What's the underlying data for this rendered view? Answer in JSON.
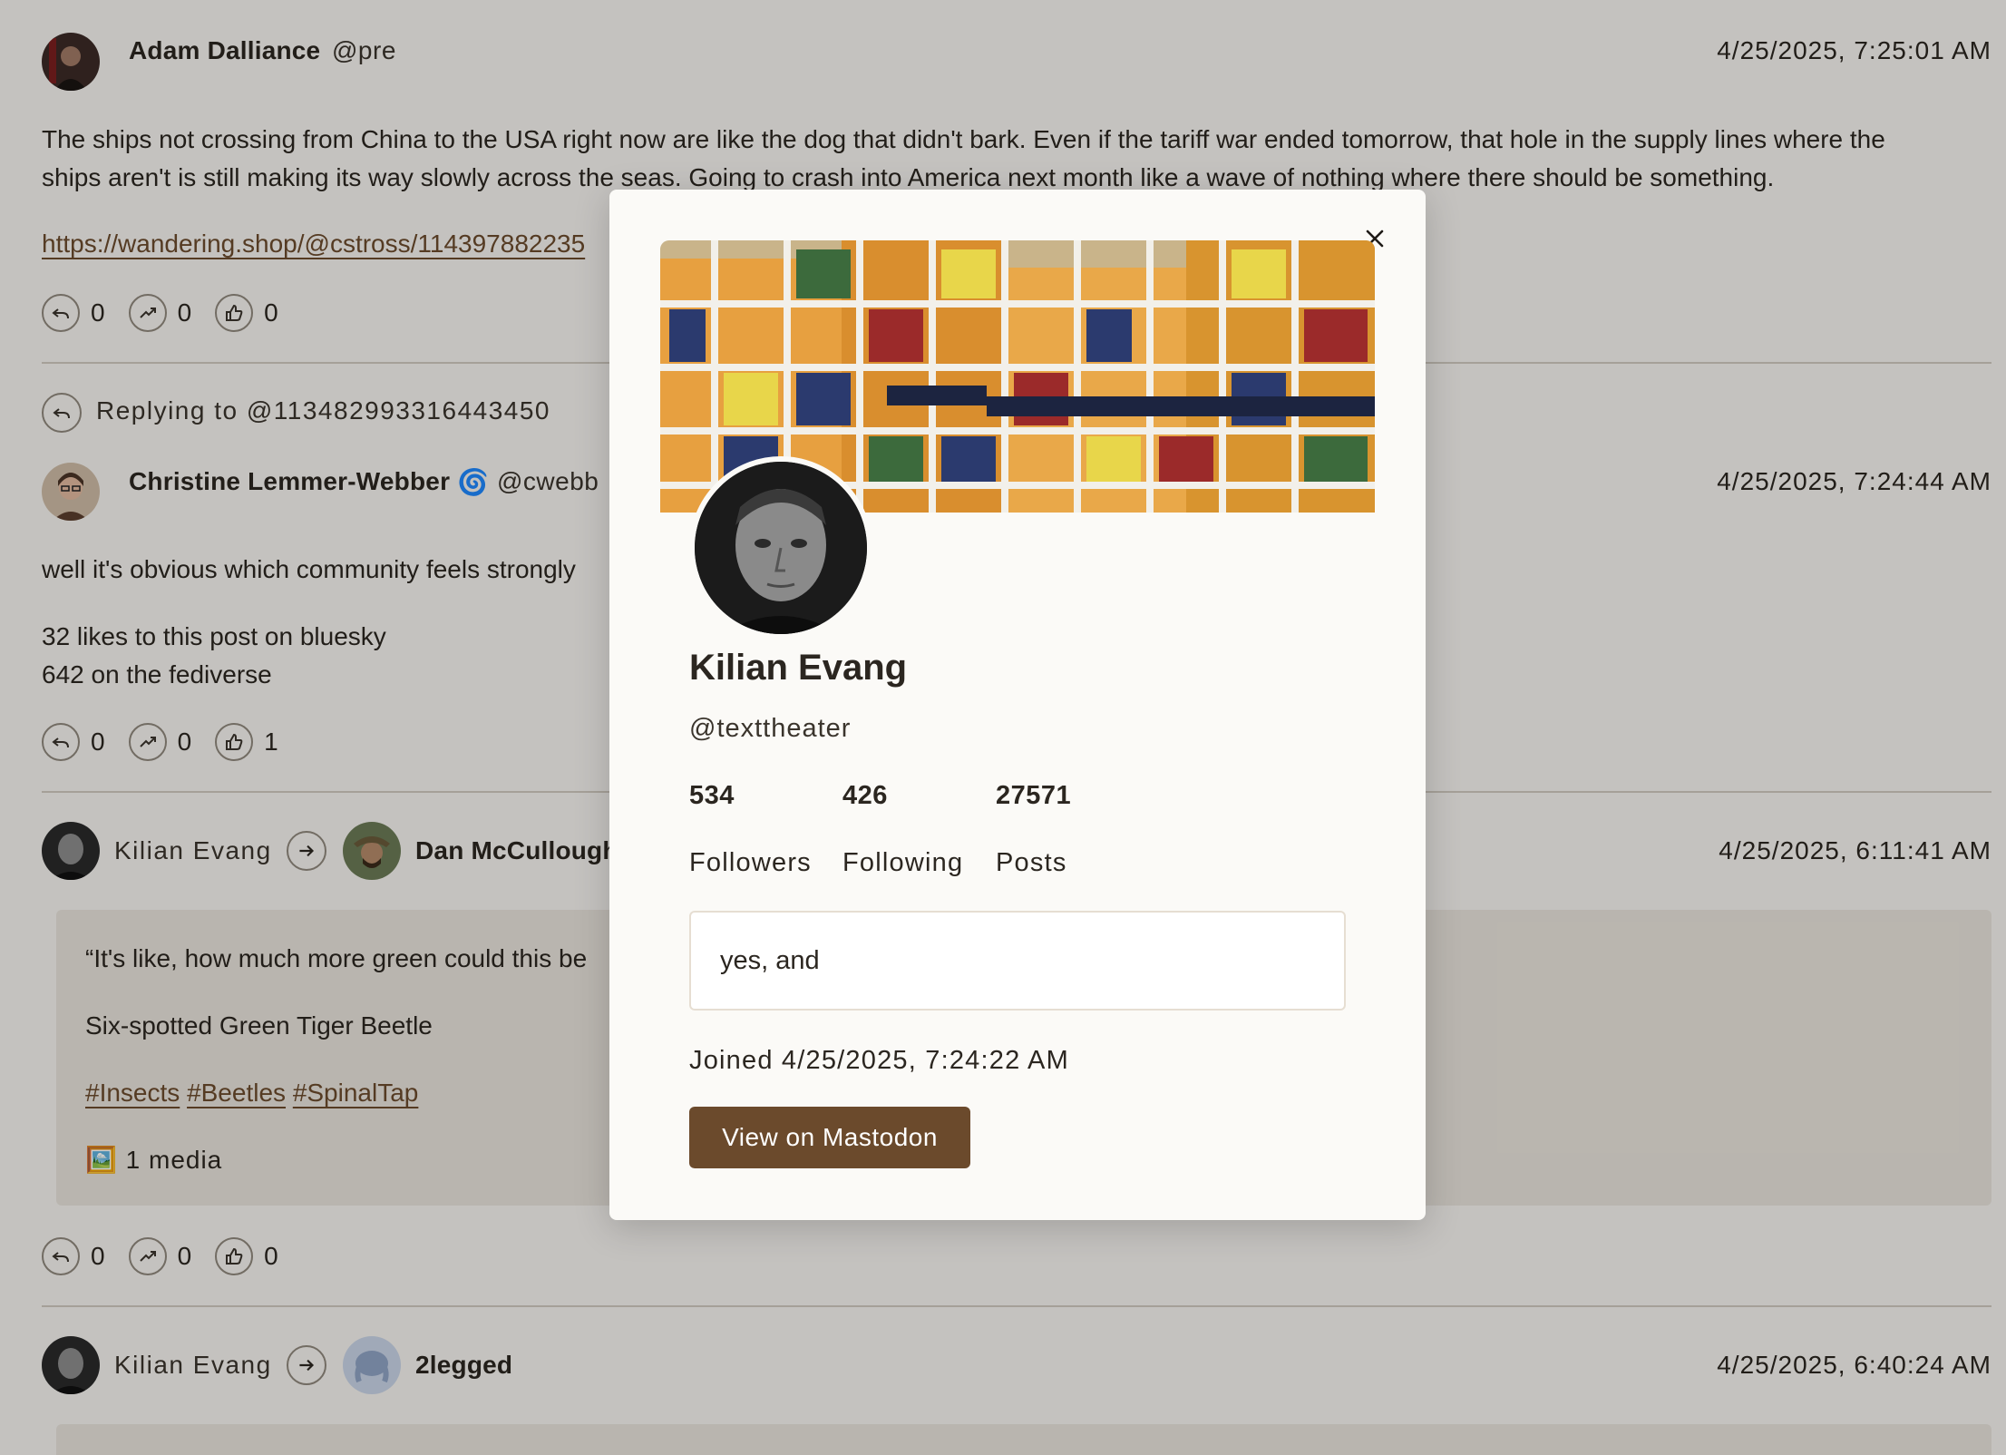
{
  "posts": [
    {
      "author_name": "Adam Dalliance",
      "author_handle": "@pre",
      "timestamp": "4/25/2025, 7:25:01 AM",
      "text_line1": "The ships not crossing from China to the USA right now are like the dog that didn't bark. Even if the tariff war ended tomorrow, that hole in the supply lines where the",
      "text_line2": "ships aren't is still making its way slowly across the seas. Going to crash into America next month like a wave of nothing where there should be something.",
      "link": "https://wandering.shop/@cstross/114397882235",
      "replies": "0",
      "boosts": "0",
      "likes": "0"
    },
    {
      "reply_to": "Replying to @113482993316443450",
      "author_name": "Christine Lemmer-Webber",
      "author_badge": "🌀",
      "author_handle": "@cwebb",
      "timestamp": "4/25/2025, 7:24:44 AM",
      "text_line1": "well it's obvious which community feels strongly",
      "text_line2": "32 likes to this post on bluesky",
      "text_line3": "642 on the fediverse",
      "replies": "0",
      "boosts": "0",
      "likes": "1"
    },
    {
      "booster_name": "Kilian Evang",
      "author_name": "Dan McCullough",
      "timestamp": "4/25/2025, 6:11:41 AM",
      "quote_line1": "“It's like, how much more green could this be",
      "quote_line2": "Six-spotted Green Tiger Beetle",
      "tags": [
        "#Insects",
        "#Beetles",
        "#SpinalTap"
      ],
      "media": "🖼️ 1 media",
      "replies": "0",
      "boosts": "0",
      "likes": "0"
    },
    {
      "booster_name": "Kilian Evang",
      "author_name": "2legged",
      "timestamp": "4/25/2025, 6:40:24 AM"
    }
  ],
  "profile_modal": {
    "name": "Kilian Evang",
    "handle": "@texttheater",
    "followers_count": "534",
    "following_count": "426",
    "posts_count": "27571",
    "followers_label": "Followers",
    "following_label": "Following",
    "posts_label": "Posts",
    "bio": "yes, and",
    "joined": "Joined 4/25/2025, 7:24:22 AM",
    "view_button": "View on Mastodon",
    "close_glyph": "×"
  },
  "colors": {
    "accent": "#6b4a2c",
    "background": "#f5f3ef",
    "modal_background": "#fbfaf7"
  },
  "icons": [
    "reply-icon",
    "boost-icon",
    "like-icon",
    "arrow-right-icon",
    "close-icon"
  ]
}
